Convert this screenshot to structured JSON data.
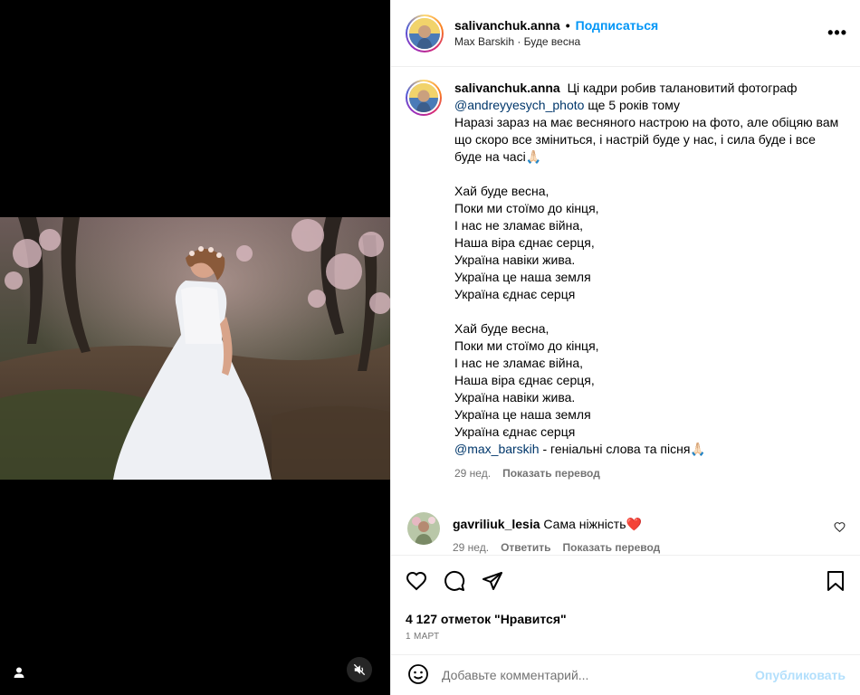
{
  "post": {
    "author": "salivanchuk.anna",
    "dot": "•",
    "follow_label": "Подписаться",
    "audio": "Max Barskih · Буде весна",
    "more_label": "•••"
  },
  "caption": {
    "username": "salivanchuk.anna",
    "intro": "Ці кадри робив талановитий фотограф",
    "mention_photographer": "@andreyyesych_photo",
    "intro_tail": "ще 5 років тому",
    "paragraph": "Наразі зараз на має весняного настрою на фото, але обіцяю вам що скоро все зміниться, і настрій буде у нас, і сила буде і все буде на часі🙏🏻",
    "verse1": [
      "Хай буде весна,",
      "Поки ми стоїмо до кінця,",
      "І нас не зламає війна,",
      "Наша віра єднає серця,",
      "Україна навіки жива.",
      "Україна це наша земля",
      "Україна єднає серця"
    ],
    "verse2": [
      "Хай буде весна,",
      "Поки ми стоїмо до кінця,",
      "І нас не зламає війна,",
      "Наша віра єднає серця,",
      "Україна навіки жива.",
      "Україна це наша земля",
      "Україна єднає серця"
    ],
    "mention_singer": "@max_barskih",
    "outro": "- геніальні слова та пісня🙏🏻",
    "age": "29 нед.",
    "translate_label": "Показать перевод"
  },
  "comment": {
    "username": "gavriliuk_lesia",
    "text": "Сама ніжність❤️",
    "age": "29 нед.",
    "reply_label": "Ответить",
    "translate_label": "Показать перевод"
  },
  "engagement": {
    "likes": "4 127 отметок \"Нравится\"",
    "date": "1 МАРТ"
  },
  "composer": {
    "placeholder": "Добавьте комментарий...",
    "publish_label": "Опубликовать"
  }
}
